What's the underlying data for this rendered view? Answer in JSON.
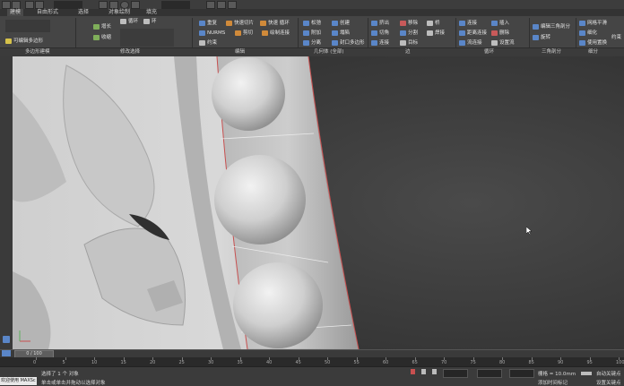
{
  "toolbar": {
    "buttons": [
      "undo-icon",
      "redo-icon",
      "link-icon",
      "unlink-icon",
      "select-icon",
      "move-icon",
      "rotate-icon",
      "scale-icon",
      "snap-icon"
    ]
  },
  "ribbon_tabs": [
    "建模",
    "自由形式",
    "选择",
    "对象绘制",
    "填充"
  ],
  "ribbon": {
    "groups": [
      {
        "name": "多边形建模",
        "buttons": [
          {
            "label": "可编辑多边形",
            "icon": "poly-icon"
          }
        ]
      },
      {
        "name": "修改选择",
        "buttons": [
          {
            "label": "增长",
            "icon": "grow-icon"
          },
          {
            "label": "收缩",
            "icon": "shrink-icon"
          },
          {
            "label": "循环",
            "icon": "loop-icon"
          },
          {
            "label": "环",
            "icon": "ring-icon"
          }
        ]
      },
      {
        "name": "编辑",
        "buttons": [
          {
            "label": "重复",
            "icon": "repeat-icon"
          },
          {
            "label": "快速切片",
            "icon": "quickslice-icon"
          },
          {
            "label": "快速 循环",
            "icon": "quickloop-icon"
          },
          {
            "label": "NURMS",
            "icon": "nurms-icon"
          },
          {
            "label": "剪切",
            "icon": "cut-icon"
          },
          {
            "label": "绘制连接",
            "icon": "paintconnect-icon"
          },
          {
            "label": "约束",
            "icon": "constraint-icon"
          }
        ]
      },
      {
        "name": "几何体 (全部)",
        "buttons": [
          {
            "label": "松弛",
            "icon": "relax-icon"
          },
          {
            "label": "创建",
            "icon": "create-icon"
          },
          {
            "label": "附加",
            "icon": "attach-icon"
          },
          {
            "label": "塌陷",
            "icon": "collapse-icon"
          },
          {
            "label": "分离",
            "icon": "detach-icon"
          },
          {
            "label": "封口多边形",
            "icon": "cap-icon"
          }
        ]
      },
      {
        "name": "边",
        "buttons": [
          {
            "label": "挤出",
            "icon": "extrude-icon"
          },
          {
            "label": "移除",
            "icon": "remove-icon"
          },
          {
            "label": "桥",
            "icon": "bridge-icon"
          },
          {
            "label": "切角",
            "icon": "chamfer-icon"
          },
          {
            "label": "分割",
            "icon": "split-icon"
          },
          {
            "label": "焊接",
            "icon": "weld-icon"
          },
          {
            "label": "连接",
            "icon": "connect-icon"
          },
          {
            "label": "目标",
            "icon": "target-icon"
          }
        ]
      },
      {
        "name": "循环",
        "buttons": [
          {
            "label": "连接",
            "icon": "connect-icon"
          },
          {
            "label": "插入",
            "icon": "insert-icon"
          },
          {
            "label": "距离连接",
            "icon": "distconnect-icon"
          },
          {
            "label": "删除",
            "icon": "delete-icon"
          },
          {
            "label": "流连接",
            "icon": "flowconnect-icon"
          },
          {
            "label": "设置流",
            "icon": "setflow-icon"
          }
        ]
      },
      {
        "name": "三角剖分",
        "buttons": [
          {
            "label": "编辑三角剖分",
            "icon": "edittri-icon"
          },
          {
            "label": "旋转",
            "icon": "turn-icon"
          }
        ]
      },
      {
        "name": "细分",
        "buttons": [
          {
            "label": "网格平滑",
            "icon": "meshsmooth-icon"
          },
          {
            "label": "细化",
            "icon": "tessellate-icon"
          },
          {
            "label": "使用置换",
            "icon": "displace-icon"
          }
        ]
      }
    ],
    "overflow_label": "约束"
  },
  "timeline": {
    "thumb": "0 / 100",
    "ticks": [
      "0",
      "5",
      "10",
      "15",
      "20",
      "25",
      "30",
      "35",
      "40",
      "45",
      "50",
      "55",
      "60",
      "65",
      "70",
      "75",
      "80",
      "85",
      "90",
      "95",
      "100"
    ]
  },
  "status": {
    "selection": "选择了 1 个 对象",
    "prompt": "单击或单击并拖动以选择对象",
    "maxscript": "欢迎使用 MAXSc",
    "grid": "栅格 = 10.0mm",
    "autokey": "自动关键点",
    "setkey": "设置关键点",
    "add_time_tag": "添加时间标记",
    "filter": "选定对象"
  },
  "colors": {
    "viewport_bg": "#3e3e3e",
    "ribbon_bg": "#454545",
    "selection_edge": "#c85050"
  }
}
